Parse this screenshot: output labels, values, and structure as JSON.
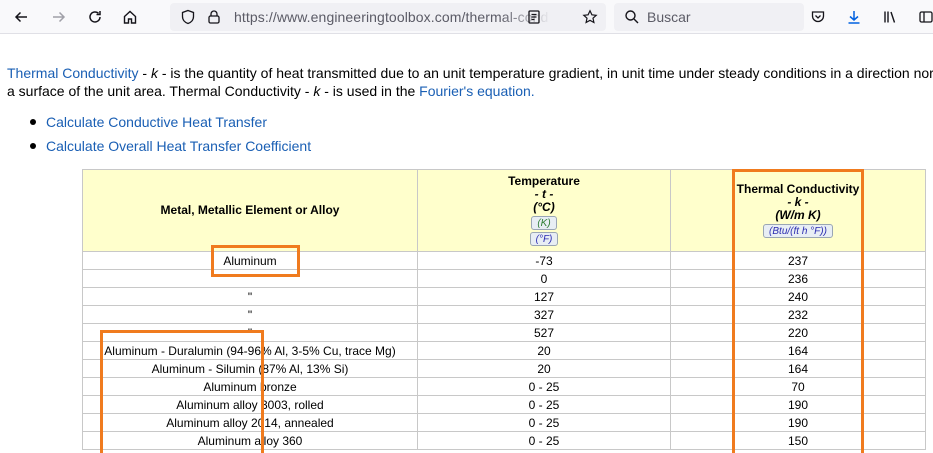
{
  "browser": {
    "url_host": "https://www.engineeringtoolbox.com",
    "url_path": "/thermal-cond",
    "search_placeholder": "Buscar",
    "icons": [
      "back-arrow-icon",
      "forward-arrow-icon",
      "reload-icon",
      "home-icon",
      "shield-icon",
      "lock-icon",
      "reader-view-icon",
      "bookmark-star-icon",
      "search-icon",
      "pocket-icon",
      "download-icon",
      "library-icon",
      "sidebar-icon"
    ]
  },
  "intro": {
    "link_term": "Thermal Conductivity",
    "line1_a": " - ",
    "sym_k": "k",
    "line1_b": " - is the quantity of heat transmitted due to an unit temperature gradient, in unit time under steady conditions in a direction normal to",
    "line2_a": "a surface of the unit area. Thermal Conductivity - ",
    "line2_b": " - is used in the ",
    "link_fourier": "Fourier's equation."
  },
  "links": [
    "Calculate Conductive Heat Transfer",
    "Calculate Overall Heat Transfer Coefficient"
  ],
  "table": {
    "headers": {
      "metal": "Metal, Metallic Element or Alloy",
      "temp_title": "Temperature",
      "temp_sym": "- t -",
      "temp_unit": "(°C)",
      "temp_btn_k": "(K)",
      "temp_btn_f": "(°F)",
      "cond_title": "Thermal Conductivity",
      "cond_sym": "- k -",
      "cond_unit": "(W/m K)",
      "cond_btn": "(Btu/(ft h °F))"
    },
    "rows": [
      {
        "metal": "Aluminum",
        "temp": "-73",
        "k": "237"
      },
      {
        "metal": "",
        "temp": "0",
        "k": "236"
      },
      {
        "metal": "\"",
        "temp": "127",
        "k": "240"
      },
      {
        "metal": "\"",
        "temp": "327",
        "k": "232"
      },
      {
        "metal": "\"",
        "temp": "527",
        "k": "220"
      },
      {
        "metal": "Aluminum - Duralumin (94-96% Al, 3-5% Cu, trace Mg)",
        "temp": "20",
        "k": "164"
      },
      {
        "metal": "Aluminum - Silumin (87% Al, 13% Si)",
        "temp": "20",
        "k": "164"
      },
      {
        "metal": "Aluminum bronze",
        "temp": "0 - 25",
        "k": "70"
      },
      {
        "metal": "Aluminum alloy 3003, rolled",
        "temp": "0 - 25",
        "k": "190"
      },
      {
        "metal": "Aluminum alloy 2014, annealed",
        "temp": "0 - 25",
        "k": "190"
      },
      {
        "metal": "Aluminum alloy 360",
        "temp": "0 - 25",
        "k": "150"
      }
    ]
  },
  "colors": {
    "highlight": "#f07b1e",
    "header_bg": "#ffffcc",
    "link": "#1a5fb4"
  }
}
